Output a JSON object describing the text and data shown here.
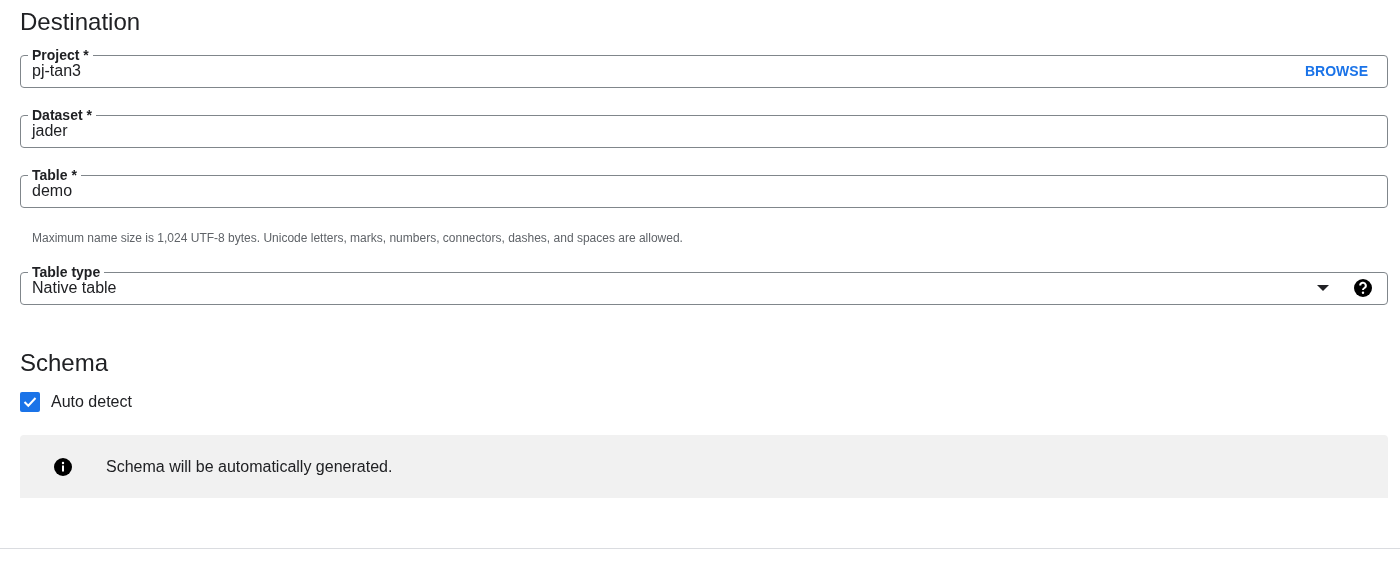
{
  "destination": {
    "title": "Destination",
    "fields": [
      {
        "kind": "text",
        "label": "Project *",
        "value": "pj-tan3",
        "action": "BROWSE"
      },
      {
        "kind": "text",
        "label": "Dataset *",
        "value": "jader"
      },
      {
        "kind": "text",
        "label": "Table *",
        "value": "demo",
        "hint": "Maximum name size is 1,024 UTF-8 bytes. Unicode letters, marks, numbers, connectors, dashes, and spaces are allowed."
      },
      {
        "kind": "select",
        "label": "Table type",
        "value": "Native table"
      }
    ]
  },
  "schema": {
    "title": "Schema",
    "auto_detect": {
      "label": "Auto detect",
      "checked": true
    },
    "info": "Schema will be automatically generated."
  }
}
